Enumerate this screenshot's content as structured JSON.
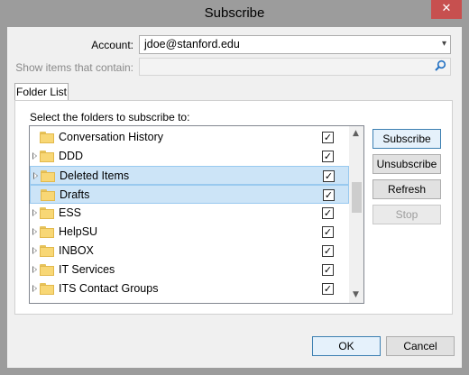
{
  "window": {
    "title": "Subscribe",
    "close_glyph": "✕"
  },
  "account": {
    "label": "Account:",
    "value": "jdoe@stanford.edu",
    "arrow": "▾"
  },
  "filter": {
    "label": "Show items that contain:",
    "value": "",
    "placeholder": ""
  },
  "tabs": [
    {
      "label": "Folder List"
    }
  ],
  "folder_panel": {
    "caption": "Select the folders to subscribe to:",
    "folders": [
      {
        "name": "Conversation History",
        "expandable": false,
        "checked": true,
        "selected": false
      },
      {
        "name": "DDD",
        "expandable": true,
        "checked": true,
        "selected": false
      },
      {
        "name": "Deleted Items",
        "expandable": true,
        "checked": true,
        "selected": true
      },
      {
        "name": "Drafts",
        "expandable": false,
        "checked": true,
        "selected": true
      },
      {
        "name": "ESS",
        "expandable": true,
        "checked": true,
        "selected": false
      },
      {
        "name": "HelpSU",
        "expandable": true,
        "checked": true,
        "selected": false
      },
      {
        "name": "INBOX",
        "expandable": true,
        "checked": true,
        "selected": false
      },
      {
        "name": "IT Services",
        "expandable": true,
        "checked": true,
        "selected": false
      },
      {
        "name": "ITS Contact Groups",
        "expandable": true,
        "checked": true,
        "selected": false
      }
    ],
    "check_glyph": "✓",
    "scroll_up": "▲",
    "scroll_down": "▼"
  },
  "side_buttons": {
    "subscribe": "Subscribe",
    "unsubscribe": "Unsubscribe",
    "refresh": "Refresh",
    "stop": "Stop"
  },
  "footer": {
    "ok": "OK",
    "cancel": "Cancel"
  },
  "colors": {
    "selection": "#cce4f7",
    "selection_border": "#99c9ef",
    "close_button": "#c7504f",
    "folder": "#f8d775"
  }
}
